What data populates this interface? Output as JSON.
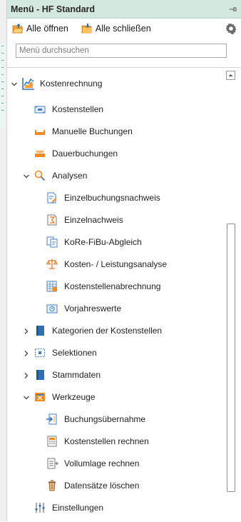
{
  "panel": {
    "title": "Menü - HF Standard",
    "pin_icon": "pin-icon"
  },
  "toolbar": {
    "open_all_label": "Alle öffnen",
    "close_all_label": "Alle schließen",
    "settings_icon": "gear-icon"
  },
  "search": {
    "placeholder": "Menü durchsuchen",
    "value": ""
  },
  "tree": {
    "root": {
      "label": "Kostenrechnung",
      "icon": "chart-icon",
      "expanded": true
    },
    "items": [
      {
        "label": "Kostenstellen",
        "icon": "cost-center-icon"
      },
      {
        "label": "Manuelle Buchungen",
        "icon": "tray-icon"
      },
      {
        "label": "Dauerbuchungen",
        "icon": "stack-icon"
      },
      {
        "label": "Analysen",
        "icon": "magnifier-icon",
        "expanded": true,
        "children": [
          {
            "label": "Einzelbuchungsnachweis",
            "icon": "doc-edit-icon"
          },
          {
            "label": "Einzelnachweis",
            "icon": "doc-sum-icon"
          },
          {
            "label": "KoRe-FiBu-Abgleich",
            "icon": "compare-icon"
          },
          {
            "label": "Kosten- / Leistungsanalyse",
            "icon": "scale-icon"
          },
          {
            "label": "Kostenstellenabrechnung",
            "icon": "calc-sheet-icon"
          },
          {
            "label": "Vorjahreswerte",
            "icon": "history-icon"
          }
        ]
      },
      {
        "label": "Kategorien der Kostenstellen",
        "icon": "book-icon",
        "expanded": false
      },
      {
        "label": "Selektionen",
        "icon": "selection-icon",
        "expanded": false
      },
      {
        "label": "Stammdaten",
        "icon": "book-icon",
        "expanded": false
      },
      {
        "label": "Werkzeuge",
        "icon": "tools-icon",
        "expanded": true,
        "children": [
          {
            "label": "Buchungsübernahme",
            "icon": "import-icon"
          },
          {
            "label": "Kostenstellen rechnen",
            "icon": "calc-icon"
          },
          {
            "label": "Vollumlage rechnen",
            "icon": "allocate-icon"
          },
          {
            "label": "Datensätze löschen",
            "icon": "trash-icon"
          }
        ]
      },
      {
        "label": "Einstellungen",
        "icon": "sliders-icon"
      }
    ]
  },
  "colors": {
    "titlebar_bg": "#d3e9df",
    "accent_blue": "#2f6fb3",
    "accent_orange": "#f0902a"
  }
}
